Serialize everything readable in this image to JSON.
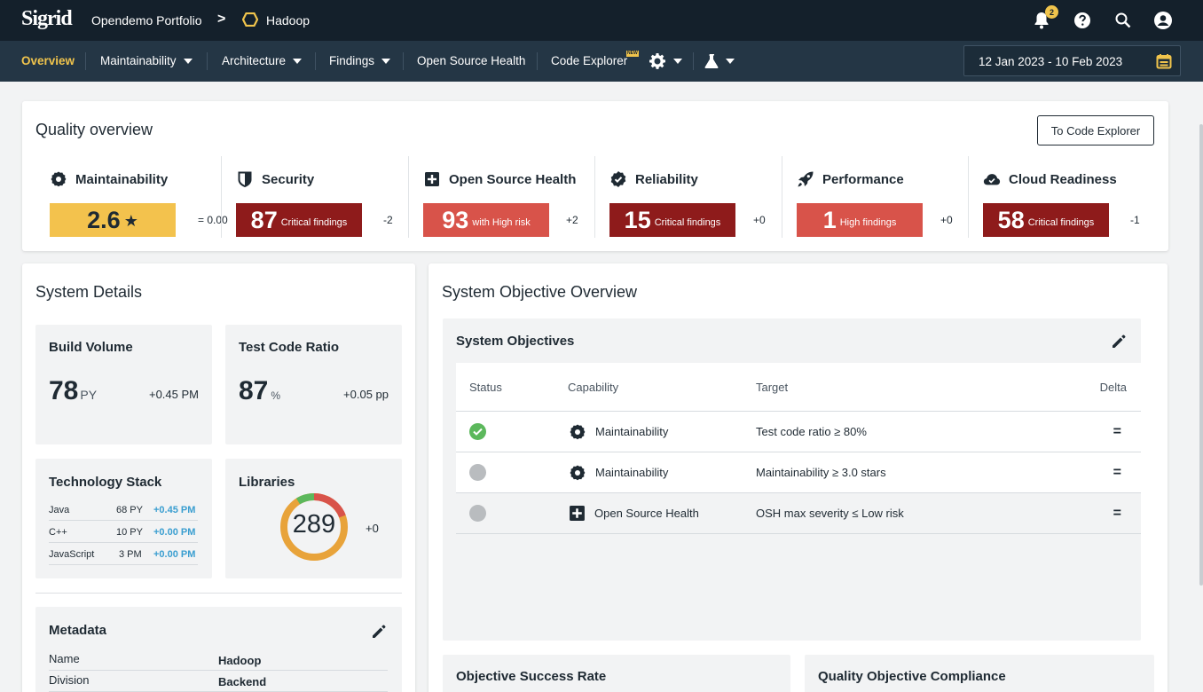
{
  "app": {
    "logo_text": "Sigrid"
  },
  "header": {
    "portfolio": "Opendemo Portfolio",
    "separator": ">",
    "system": "Hadoop",
    "notification_count": "2"
  },
  "nav": {
    "items": [
      {
        "label": "Overview",
        "active": true
      },
      {
        "label": "Maintainability",
        "dropdown": true
      },
      {
        "label": "Architecture",
        "dropdown": true
      },
      {
        "label": "Findings",
        "dropdown": true
      },
      {
        "label": "Open Source Health"
      },
      {
        "label": "Code Explorer",
        "badge": "NEW"
      }
    ],
    "date_range": "12 Jan 2023 - 10 Feb 2023"
  },
  "quality": {
    "title": "Quality overview",
    "button": "To Code Explorer",
    "metrics": [
      {
        "name": "Maintainability",
        "icon": "maintainability-icon",
        "value": "2.6",
        "star": "★",
        "note": "",
        "delta": "= 0.00",
        "color": "#f3c24d",
        "text_color": "#1f2a33"
      },
      {
        "name": "Security",
        "icon": "shield-icon",
        "value": "87",
        "note": "Critical findings",
        "delta": "-2",
        "color": "#8e1b1b",
        "text_color": "#ffffff"
      },
      {
        "name": "Open Source Health",
        "icon": "plus-box-icon",
        "value": "93",
        "note": "with High risk",
        "delta": "+2",
        "color": "#d8534a",
        "text_color": "#ffffff"
      },
      {
        "name": "Reliability",
        "icon": "verified-badge-icon",
        "value": "15",
        "note": "Critical findings",
        "delta": "+0",
        "color": "#8e1b1b",
        "text_color": "#ffffff"
      },
      {
        "name": "Performance",
        "icon": "rocket-icon",
        "value": "1",
        "note": "High findings",
        "delta": "+0",
        "color": "#d8534a",
        "text_color": "#ffffff"
      },
      {
        "name": "Cloud Readiness",
        "icon": "cloud-icon",
        "value": "58",
        "note": "Critical findings",
        "delta": "-1",
        "color": "#8e1b1b",
        "text_color": "#ffffff"
      }
    ]
  },
  "system_details": {
    "title": "System Details",
    "build_volume": {
      "title": "Build Volume",
      "value": "78",
      "unit": "PY",
      "delta": "+0.45 PM"
    },
    "test_code_ratio": {
      "title": "Test Code Ratio",
      "value": "87",
      "unit": "%",
      "delta": "+0.05 pp"
    },
    "technology_stack": {
      "title": "Technology Stack",
      "rows": [
        {
          "name": "Java",
          "volume": "68 PY",
          "delta": "+0.45 PM"
        },
        {
          "name": "C++",
          "volume": "10 PY",
          "delta": "+0.00 PM"
        },
        {
          "name": "JavaScript",
          "volume": "3 PM",
          "delta": "+0.00 PM"
        }
      ]
    },
    "libraries": {
      "title": "Libraries",
      "value": "289",
      "delta": "+0",
      "segment_colors": [
        "#e8a33a",
        "#d8534a",
        "#5cb85c"
      ]
    },
    "metadata": {
      "title": "Metadata",
      "rows": [
        {
          "key": "Name",
          "value": "Hadoop"
        },
        {
          "key": "Division",
          "value": "Backend"
        }
      ]
    }
  },
  "objectives": {
    "title": "System Objective Overview",
    "panel_title": "System Objectives",
    "columns": [
      "Status",
      "Capability",
      "Target",
      "Delta"
    ],
    "rows": [
      {
        "status": "met",
        "status_color": "#5cb85c",
        "capability": "Maintainability",
        "icon": "maintainability-icon",
        "target": "Test code ratio ≥ 80%",
        "delta": "="
      },
      {
        "status": "unknown",
        "status_color": "#b9bcbf",
        "capability": "Maintainability",
        "icon": "maintainability-icon",
        "target": "Maintainability ≥ 3.0 stars",
        "delta": "="
      },
      {
        "status": "unknown",
        "status_color": "#b9bcbf",
        "capability": "Open Source Health",
        "icon": "plus-box-icon",
        "target": "OSH max severity ≤ Low risk",
        "delta": "="
      }
    ],
    "success_rate_title": "Objective Success Rate",
    "compliance_title": "Quality Objective Compliance"
  }
}
